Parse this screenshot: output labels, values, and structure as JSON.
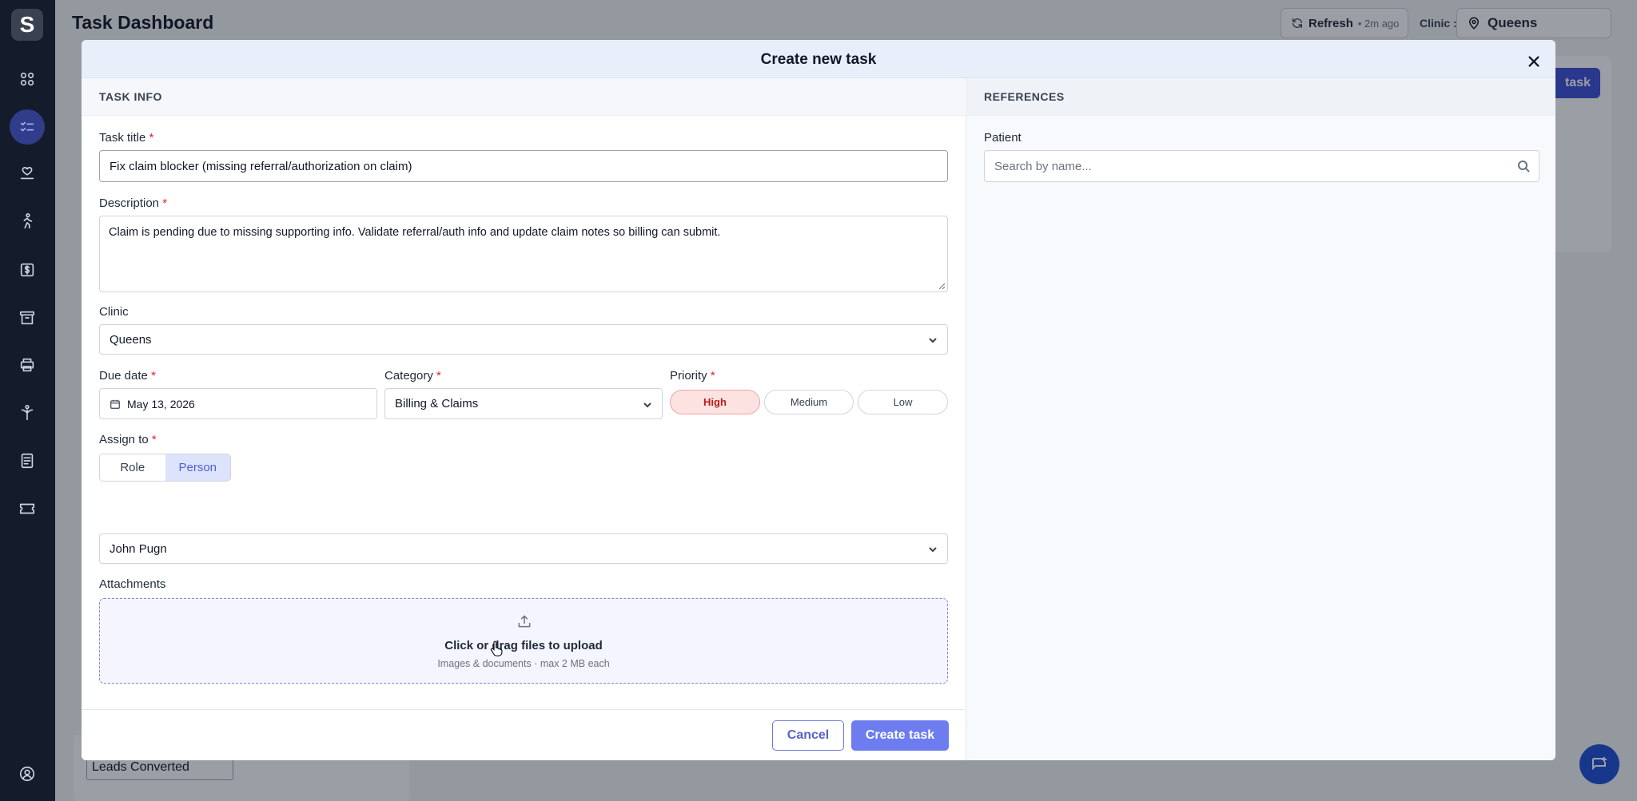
{
  "app": {
    "logo_letter": "S",
    "page_title": "Task Dashboard",
    "refresh_label": "Refresh",
    "refresh_ago": "• 2m ago",
    "clinic_label": "Clinic :",
    "clinic_value": "Queens",
    "new_task_label": "task",
    "leads_label": "Leads Converted"
  },
  "sidebar": {
    "items": [
      {
        "icon": "grid-icon"
      },
      {
        "icon": "task-list-icon",
        "active": true
      },
      {
        "icon": "heart-hand-icon"
      },
      {
        "icon": "walking-person-icon"
      },
      {
        "icon": "dollar-icon"
      },
      {
        "icon": "archive-icon"
      },
      {
        "icon": "printer-icon"
      },
      {
        "icon": "wellness-icon"
      },
      {
        "icon": "document-icon"
      },
      {
        "icon": "ticket-icon"
      },
      {
        "icon": "user-circle-icon"
      }
    ]
  },
  "modal": {
    "title": "Create new task",
    "task_info": {
      "section_label": "TASK INFO",
      "title_label": "Task title",
      "title_value": "Fix claim blocker (missing referral/authorization on claim)",
      "description_label": "Description",
      "description_value": "Claim is pending due to missing supporting info. Validate referral/auth info and update claim notes so billing can submit.",
      "clinic_label": "Clinic",
      "clinic_value": "Queens",
      "due_label": "Due date",
      "due_value": "May 13, 2026",
      "category_label": "Category",
      "category_value": "Billing & Claims",
      "priority_label": "Priority",
      "priority_options": [
        "High",
        "Medium",
        "Low"
      ],
      "priority_selected": "High",
      "assign_label": "Assign to",
      "assign_modes": [
        "Role",
        "Person"
      ],
      "assign_selected_mode": "Person",
      "assignee_value": "John Pugn",
      "attachments_label": "Attachments",
      "upload_main": "Click or drag files to upload",
      "upload_sub": "Images & documents · max 2 MB each"
    },
    "references": {
      "section_label": "REFERENCES",
      "patient_label": "Patient",
      "patient_placeholder": "Search by name..."
    },
    "buttons": {
      "cancel": "Cancel",
      "create": "Create task"
    }
  },
  "colors": {
    "sidebar_bg": "#141c2b",
    "accent": "#6d7df0",
    "priority_high": "#b91c1c"
  }
}
